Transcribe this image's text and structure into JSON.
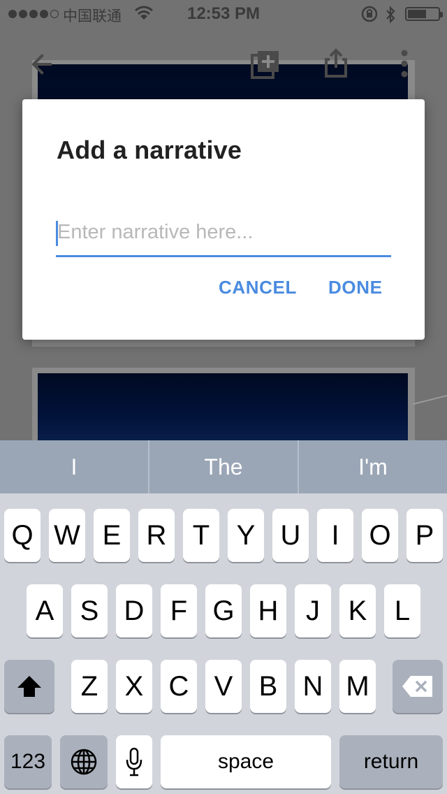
{
  "status_bar": {
    "carrier": "中国联通",
    "time": "12:53 PM"
  },
  "toolbar": {
    "icons": [
      "back-arrow-icon",
      "add-to-album-icon",
      "share-icon",
      "more-vert-icon"
    ]
  },
  "dialog": {
    "title": "Add a narrative",
    "input_placeholder": "Enter narrative here...",
    "input_value": "",
    "cancel_label": "CANCEL",
    "done_label": "DONE",
    "accent_color": "#4a8be0"
  },
  "keyboard": {
    "suggestions": [
      "I",
      "The",
      "I'm"
    ],
    "row1": [
      "Q",
      "W",
      "E",
      "R",
      "T",
      "Y",
      "U",
      "I",
      "O",
      "P"
    ],
    "row2": [
      "A",
      "S",
      "D",
      "F",
      "G",
      "H",
      "J",
      "K",
      "L"
    ],
    "row3": [
      "Z",
      "X",
      "C",
      "V",
      "B",
      "N",
      "M"
    ],
    "numbers_label": "123",
    "space_label": "space",
    "return_label": "return",
    "icons": [
      "shift-icon",
      "delete-icon",
      "globe-icon",
      "microphone-icon"
    ]
  }
}
